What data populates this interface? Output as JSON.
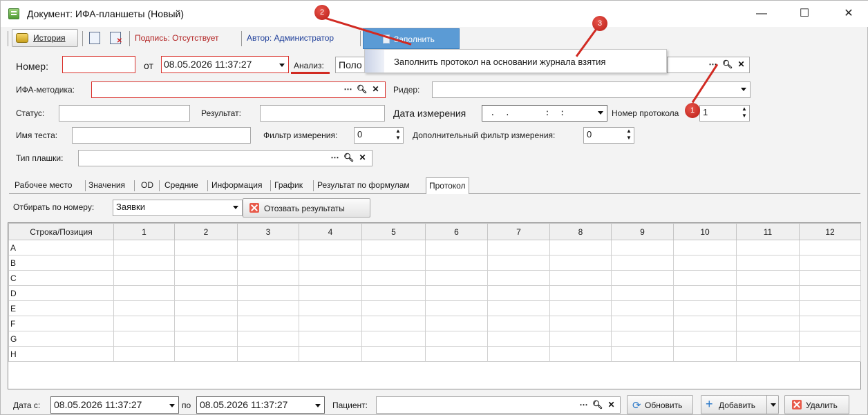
{
  "window": {
    "title": "Документ: ИФА-планшеты (Новый)",
    "minimize": "—",
    "maximize": "☐",
    "close": "✕"
  },
  "toolbar": {
    "history_label": "История",
    "signature_text": "Подпись: Отсутствует",
    "author_text": "Автор: Администратор",
    "fill_label": "Заполнить"
  },
  "fill_menu": {
    "item": "Заполнить протокол на основании журнала взятия"
  },
  "form": {
    "number_label": "Номер:",
    "number_value": "",
    "from_label": "от",
    "date_value": "08.05.2026 11:37:27",
    "analysis_label": "Анализ:",
    "analysis_value": "Поло",
    "method_label": "ИФА-методика:",
    "method_value": "",
    "reader_label": "Ридер:",
    "reader_value": "",
    "status_label": "Статус:",
    "status_value": "",
    "result_label": "Результат:",
    "result_value": "",
    "measure_date_label": "Дата измерения",
    "measure_date_value": " .  .       :  :",
    "protocol_no_label": "Номер протокола",
    "protocol_no_value": "1",
    "test_name_label": "Имя теста:",
    "test_name_value": "",
    "filter_label": "Фильтр измерения:",
    "filter_value": "0",
    "extra_filter_label": "Дополнительный фильтр измерения:",
    "extra_filter_value": "0",
    "plate_type_label": "Тип плашки:",
    "plate_type_value": ""
  },
  "tabs": [
    "Рабочее место",
    "Значения",
    "OD",
    "Средние",
    "Информация",
    "График",
    "Результат по формулам",
    "Протокол"
  ],
  "active_tab": "Протокол",
  "filter_panel": {
    "select_label": "Отбирать по номеру:",
    "select_value": "Заявки",
    "revoke_label": "Отозвать результаты"
  },
  "grid": {
    "headers": [
      "Строка/Позиция",
      "1",
      "2",
      "3",
      "4",
      "5",
      "6",
      "7",
      "8",
      "9",
      "10",
      "11",
      "12"
    ],
    "rows": [
      "A",
      "B",
      "C",
      "D",
      "E",
      "F",
      "G",
      "H"
    ]
  },
  "bottom": {
    "date_from_label": "Дата с:",
    "date_from_value": "08.05.2026 11:37:27",
    "date_to_label": "по",
    "date_to_value": "08.05.2026 11:37:27",
    "patient_label": "Пациент:",
    "patient_value": "",
    "refresh_label": "Обновить",
    "add_label": "Добавить",
    "delete_label": "Удалить"
  },
  "annotations": {
    "marker1": "1",
    "marker2": "2",
    "marker3": "3"
  },
  "colors": {
    "accent": "#5b9bd5",
    "required_border": "#d9302b",
    "annotation": "#d12a22"
  }
}
